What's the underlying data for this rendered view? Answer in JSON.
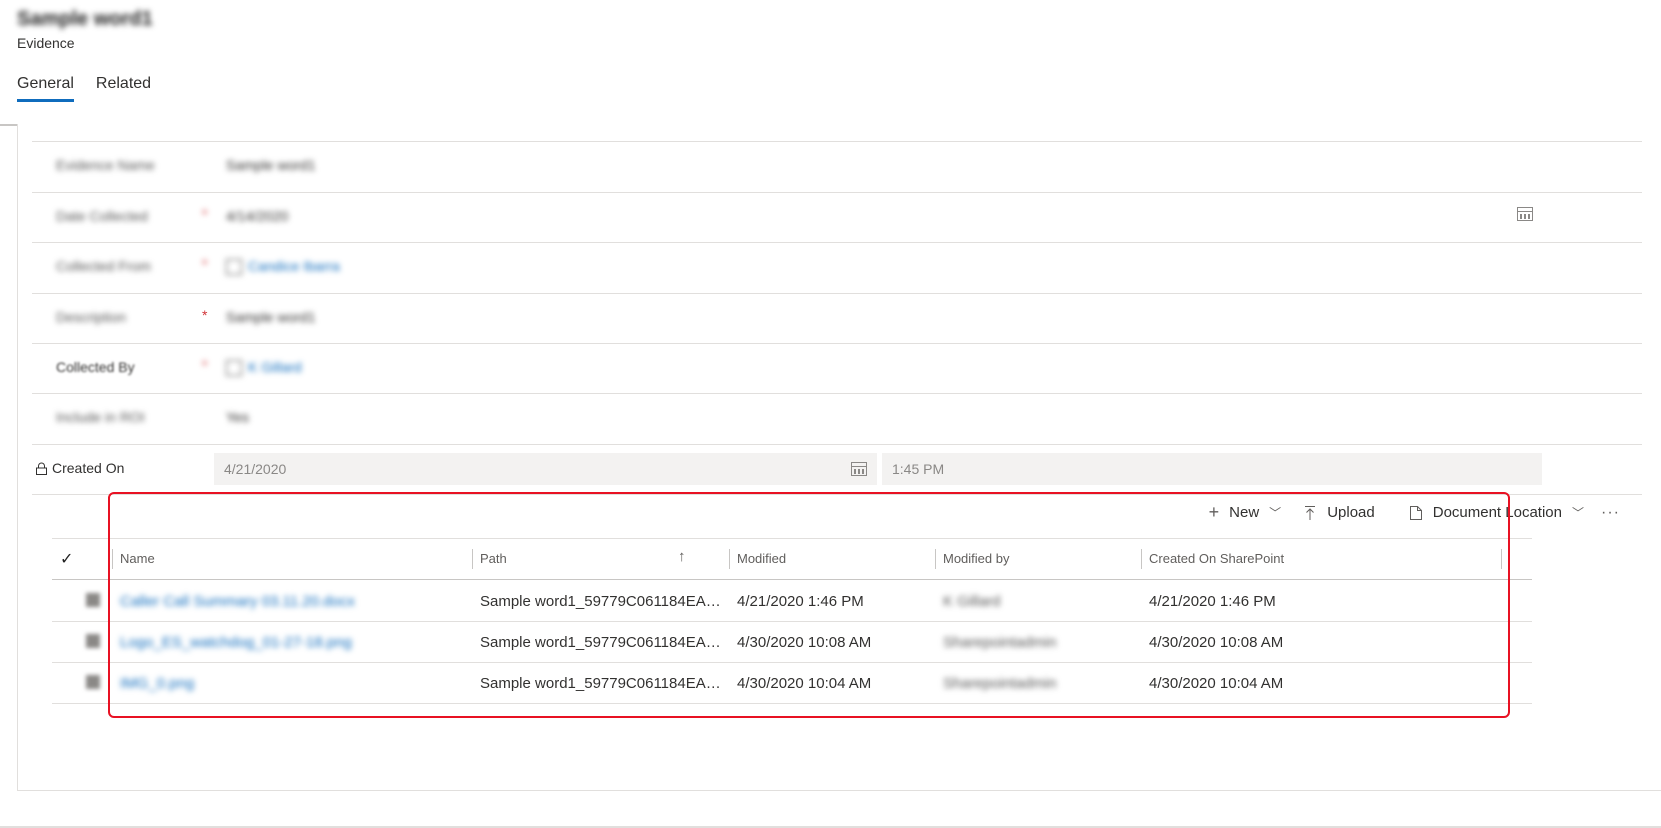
{
  "header": {
    "record_title": "Sample word1",
    "record_type": "Evidence",
    "tabs": [
      {
        "label": "General"
      },
      {
        "label": "Related"
      }
    ]
  },
  "form": {
    "fields": [
      {
        "label": "Evidence Name",
        "value": "Sample word1",
        "required": false
      },
      {
        "label": "Date Collected",
        "value": "4/14/2020",
        "required": true
      },
      {
        "label": "Collected From",
        "value": "Candice Ibarra",
        "required": true
      },
      {
        "label": "Description",
        "value": "Sample word1",
        "required": true
      },
      {
        "label": "Collected By",
        "value": "K Gillard",
        "required": true
      },
      {
        "label": "Include in ROI",
        "value": "Yes",
        "required": false
      }
    ],
    "created_on": {
      "label": "Created On",
      "date": "4/21/2020",
      "time": "1:45 PM"
    },
    "required_mark": "*"
  },
  "documents": {
    "commands": {
      "new": "New",
      "upload": "Upload",
      "document_location": "Document Location",
      "more": "···"
    },
    "columns": [
      "Name",
      "Path",
      "Modified",
      "Modified by",
      "Created On SharePoint"
    ],
    "rows": [
      {
        "name": "Caller Call Summary 03.11.20.docx",
        "path": "Sample word1_59779C061184EA…",
        "modified": "4/21/2020 1:46 PM",
        "modified_by": "K Gillard",
        "created": "4/21/2020 1:46 PM"
      },
      {
        "name": "Logo_ES_watchdog_01-27-18.png",
        "path": "Sample word1_59779C061184EA…",
        "modified": "4/30/2020 10:08 AM",
        "modified_by": "Sharepointadmin",
        "created": "4/30/2020 10:08 AM"
      },
      {
        "name": "IMG_0.png",
        "path": "Sample word1_59779C061184EA…",
        "modified": "4/30/2020 10:04 AM",
        "modified_by": "Sharepointadmin",
        "created": "4/30/2020 10:04 AM"
      }
    ]
  },
  "colors": {
    "accent": "#0f6cbd",
    "highlight": "#e81123",
    "required": "#d13438"
  }
}
